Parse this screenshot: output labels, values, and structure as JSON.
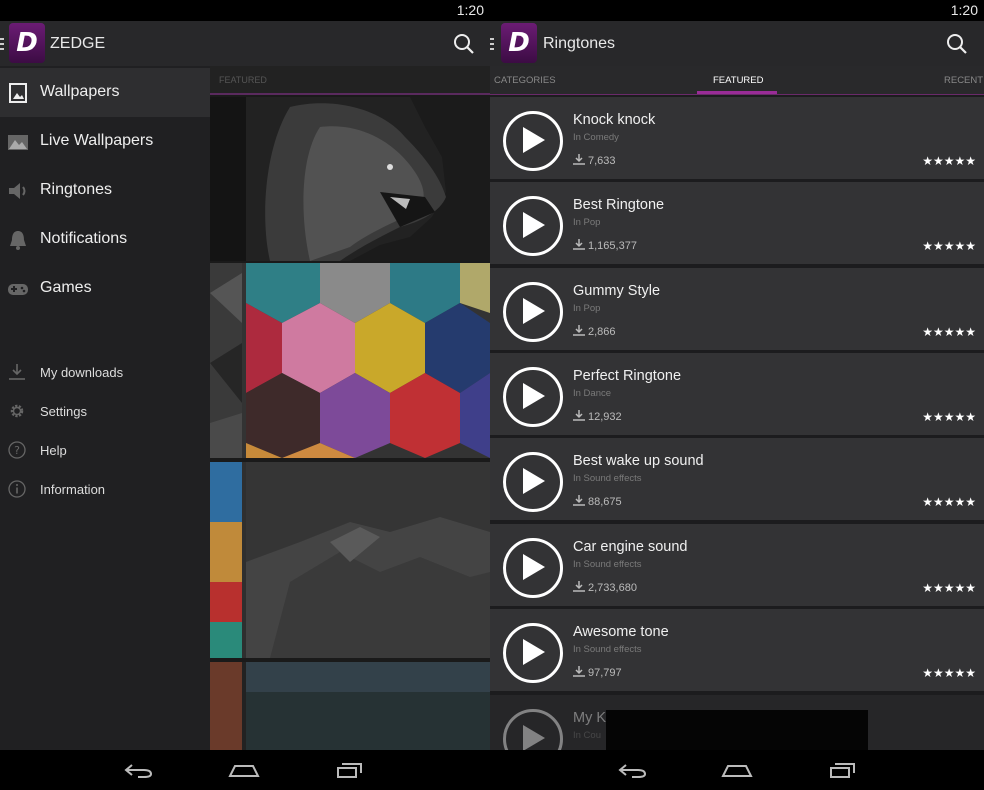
{
  "left": {
    "status_time": "1:20",
    "app_title": "ZEDGE",
    "logo_letter": "D",
    "drawer": {
      "main_items": [
        {
          "label": "Wallpapers",
          "icon": "image-icon",
          "selected": true
        },
        {
          "label": "Live Wallpapers",
          "icon": "landscape-icon",
          "selected": false
        },
        {
          "label": "Ringtones",
          "icon": "speaker-icon",
          "selected": false
        },
        {
          "label": "Notifications",
          "icon": "bell-icon",
          "selected": false
        },
        {
          "label": "Games",
          "icon": "gamepad-icon",
          "selected": false
        }
      ],
      "secondary_items": [
        {
          "label": "My downloads",
          "icon": "download-icon"
        },
        {
          "label": "Settings",
          "icon": "gear-icon"
        },
        {
          "label": "Help",
          "icon": "help-icon"
        },
        {
          "label": "Information",
          "icon": "info-icon"
        }
      ]
    },
    "background_tab": "FEATURED"
  },
  "right": {
    "status_time": "1:20",
    "app_title": "Ringtones",
    "logo_letter": "D",
    "tabs": [
      {
        "label": "CATEGORIES",
        "active": false
      },
      {
        "label": "FEATURED",
        "active": true
      },
      {
        "label": "RECENT",
        "active": false
      }
    ],
    "ringtones": [
      {
        "title": "Knock knock",
        "category": "In Comedy",
        "downloads": "7,633",
        "stars": "★★★★★"
      },
      {
        "title": "Best Ringtone",
        "category": "In Pop",
        "downloads": "1,165,377",
        "stars": "★★★★★"
      },
      {
        "title": "Gummy Style",
        "category": "In Pop",
        "downloads": "2,866",
        "stars": "★★★★★"
      },
      {
        "title": "Perfect Ringtone",
        "category": "In Dance",
        "downloads": "12,932",
        "stars": "★★★★★"
      },
      {
        "title": "Best wake up sound",
        "category": "In Sound effects",
        "downloads": "88,675",
        "stars": "★★★★★"
      },
      {
        "title": "Car engine sound",
        "category": "In Sound effects",
        "downloads": "2,733,680",
        "stars": "★★★★★"
      },
      {
        "title": "Awesome tone",
        "category": "In Sound effects",
        "downloads": "97,797",
        "stars": "★★★★★"
      },
      {
        "title": "My K",
        "category": "In Cou",
        "downloads": "",
        "stars": ""
      }
    ]
  },
  "colors": {
    "accent": "#9a2c97",
    "logo": "#5a1765",
    "row_bg": "#333335"
  },
  "navbar_icons": [
    "back-icon",
    "home-icon",
    "recents-icon"
  ]
}
